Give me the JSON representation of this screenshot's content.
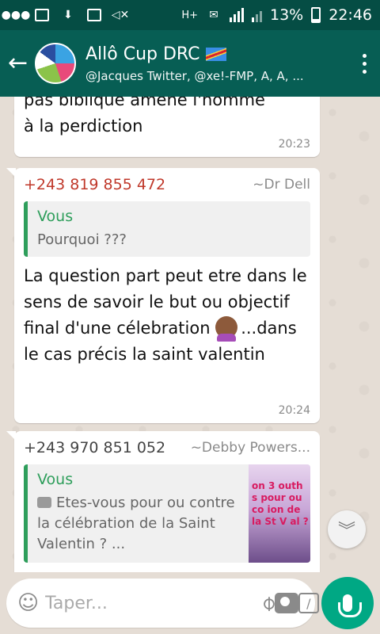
{
  "statusbar": {
    "battery_percent": "13%",
    "time": "22:46",
    "left_icons": [
      "chat-bubble-icon",
      "facebook-icon",
      "download-icon",
      "facebook-icon",
      "mute-icon"
    ],
    "network_label": "H+"
  },
  "header": {
    "title": "Allô Cup DRC",
    "subtitle": "@Jacques Twitter, @xe!-FMP, A, A, ..."
  },
  "messages": [
    {
      "text": "pas biblique amène l'homme à la perdiction",
      "time": "20:23"
    },
    {
      "sender_number": "+243 819 855 472",
      "sender_name": "~Dr Dell",
      "quote_author": "Vous",
      "quote_text": "Pourquoi ???",
      "text_part1": "La question part peut etre dans le sens de savoir le but ou objectif final d'une célebration",
      "text_part2": "...dans le cas précis la saint valentin",
      "time": "20:24"
    },
    {
      "sender_number": "+243 970 851 052",
      "sender_name": "~Debby Powers...",
      "quote_author": "Vous",
      "quote_text": "Etes-vous pour ou contre la célébration de la Saint Valentin ? ...",
      "quote_image_text": "on 3 outh s pour ou co ion de la St V al ?"
    }
  ],
  "input": {
    "placeholder": "Taper..."
  },
  "colors": {
    "app_bar": "#075e54",
    "status_bar": "#054d44",
    "accent_green": "#00a884",
    "quote_green": "#2e9e5b",
    "sender_red": "#c0392b"
  }
}
